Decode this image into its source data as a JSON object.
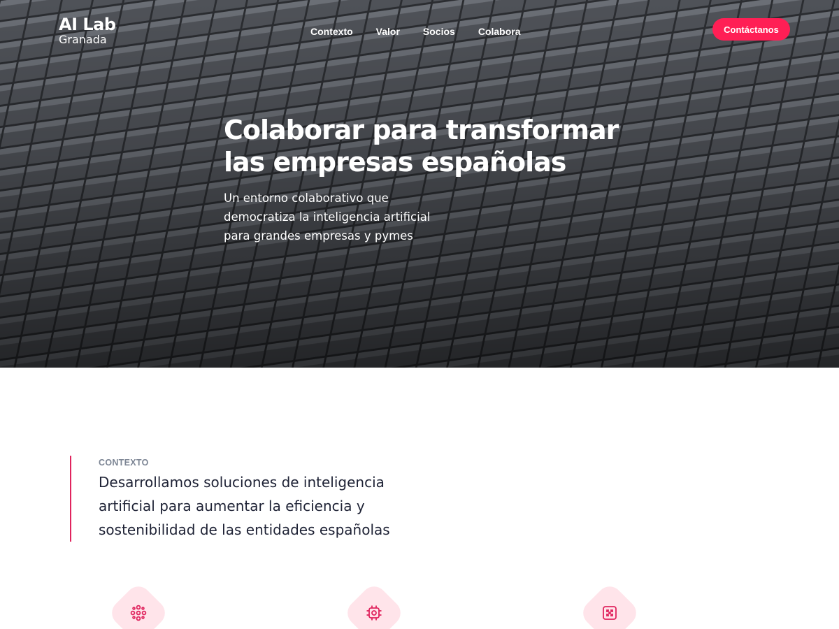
{
  "brand": {
    "name": "AI Lab",
    "location": "Granada"
  },
  "nav": {
    "items": [
      {
        "label": "Contexto"
      },
      {
        "label": "Valor"
      },
      {
        "label": "Socios"
      },
      {
        "label": "Colabora"
      }
    ],
    "cta_label": "Contáctanos"
  },
  "hero": {
    "title_line1": "Colaborar para transformar",
    "title_line2": "las empresas españolas",
    "subtitle_line1": "Un entorno colaborativo que",
    "subtitle_line2": "democratiza la inteligencia artificial",
    "subtitle_line3": "para grandes empresas y pymes"
  },
  "context": {
    "label": "CONTEXTO",
    "text": "Desarrollamos soluciones de inteligencia artificial para aumentar la eficiencia y sostenibilidad de las entidades españolas"
  },
  "features": [
    {
      "icon": "network-icon"
    },
    {
      "icon": "chip-icon"
    },
    {
      "icon": "expand-icon"
    }
  ],
  "colors": {
    "accent": "#ff1f55",
    "accent_bar": "#e0245e",
    "icon_bg": "#ffe4ea",
    "label_gray": "#7c8594"
  }
}
